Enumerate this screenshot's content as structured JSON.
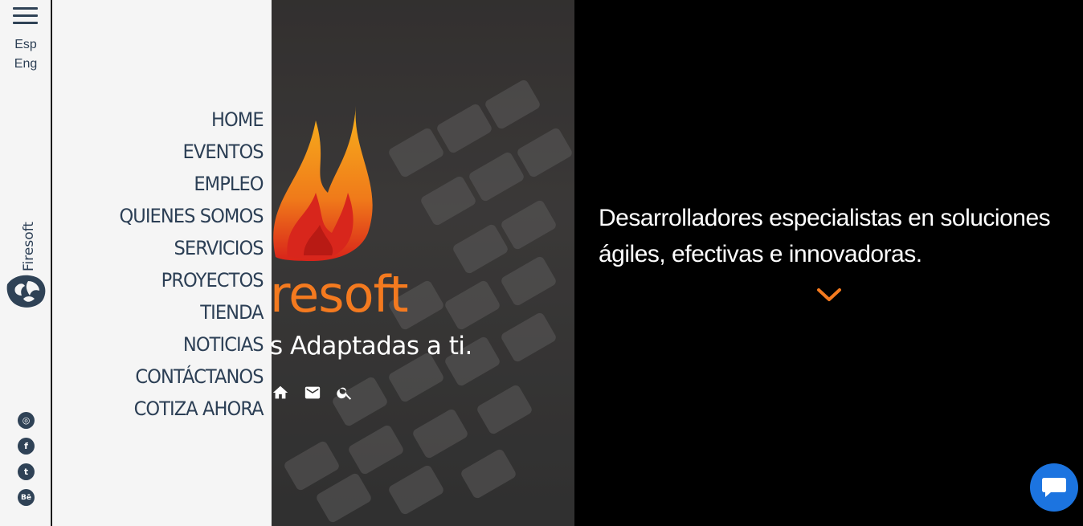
{
  "rail": {
    "languages": [
      "Esp",
      "Eng"
    ],
    "brand_vertical": "Firesoft",
    "social": [
      "instagram",
      "facebook",
      "twitter",
      "behance"
    ],
    "social_glyphs": {
      "instagram": "◎",
      "facebook": "f",
      "twitter": "t",
      "behance": "Bē"
    }
  },
  "menu": {
    "items": [
      "HOME",
      "EVENTOS",
      "EMPLEO",
      "QUIENES SOMOS",
      "SERVICIOS",
      "PROYECTOS",
      "TIENDA",
      "NOTICIAS",
      "CONTÁCTANOS",
      "COTIZA AHORA"
    ]
  },
  "hero": {
    "logo_text": "resoft",
    "tagline": "s Adaptadas a ti.",
    "tools": [
      "home-icon",
      "mail-icon",
      "search-icon"
    ]
  },
  "right": {
    "headline": "Desarrolladores especialistas en soluciones ágiles, efectivas e innovadoras."
  },
  "colors": {
    "accent": "#f47a1f",
    "navy": "#2c3f55",
    "chat": "#1c74e0",
    "panel": "#f5f5f5"
  }
}
